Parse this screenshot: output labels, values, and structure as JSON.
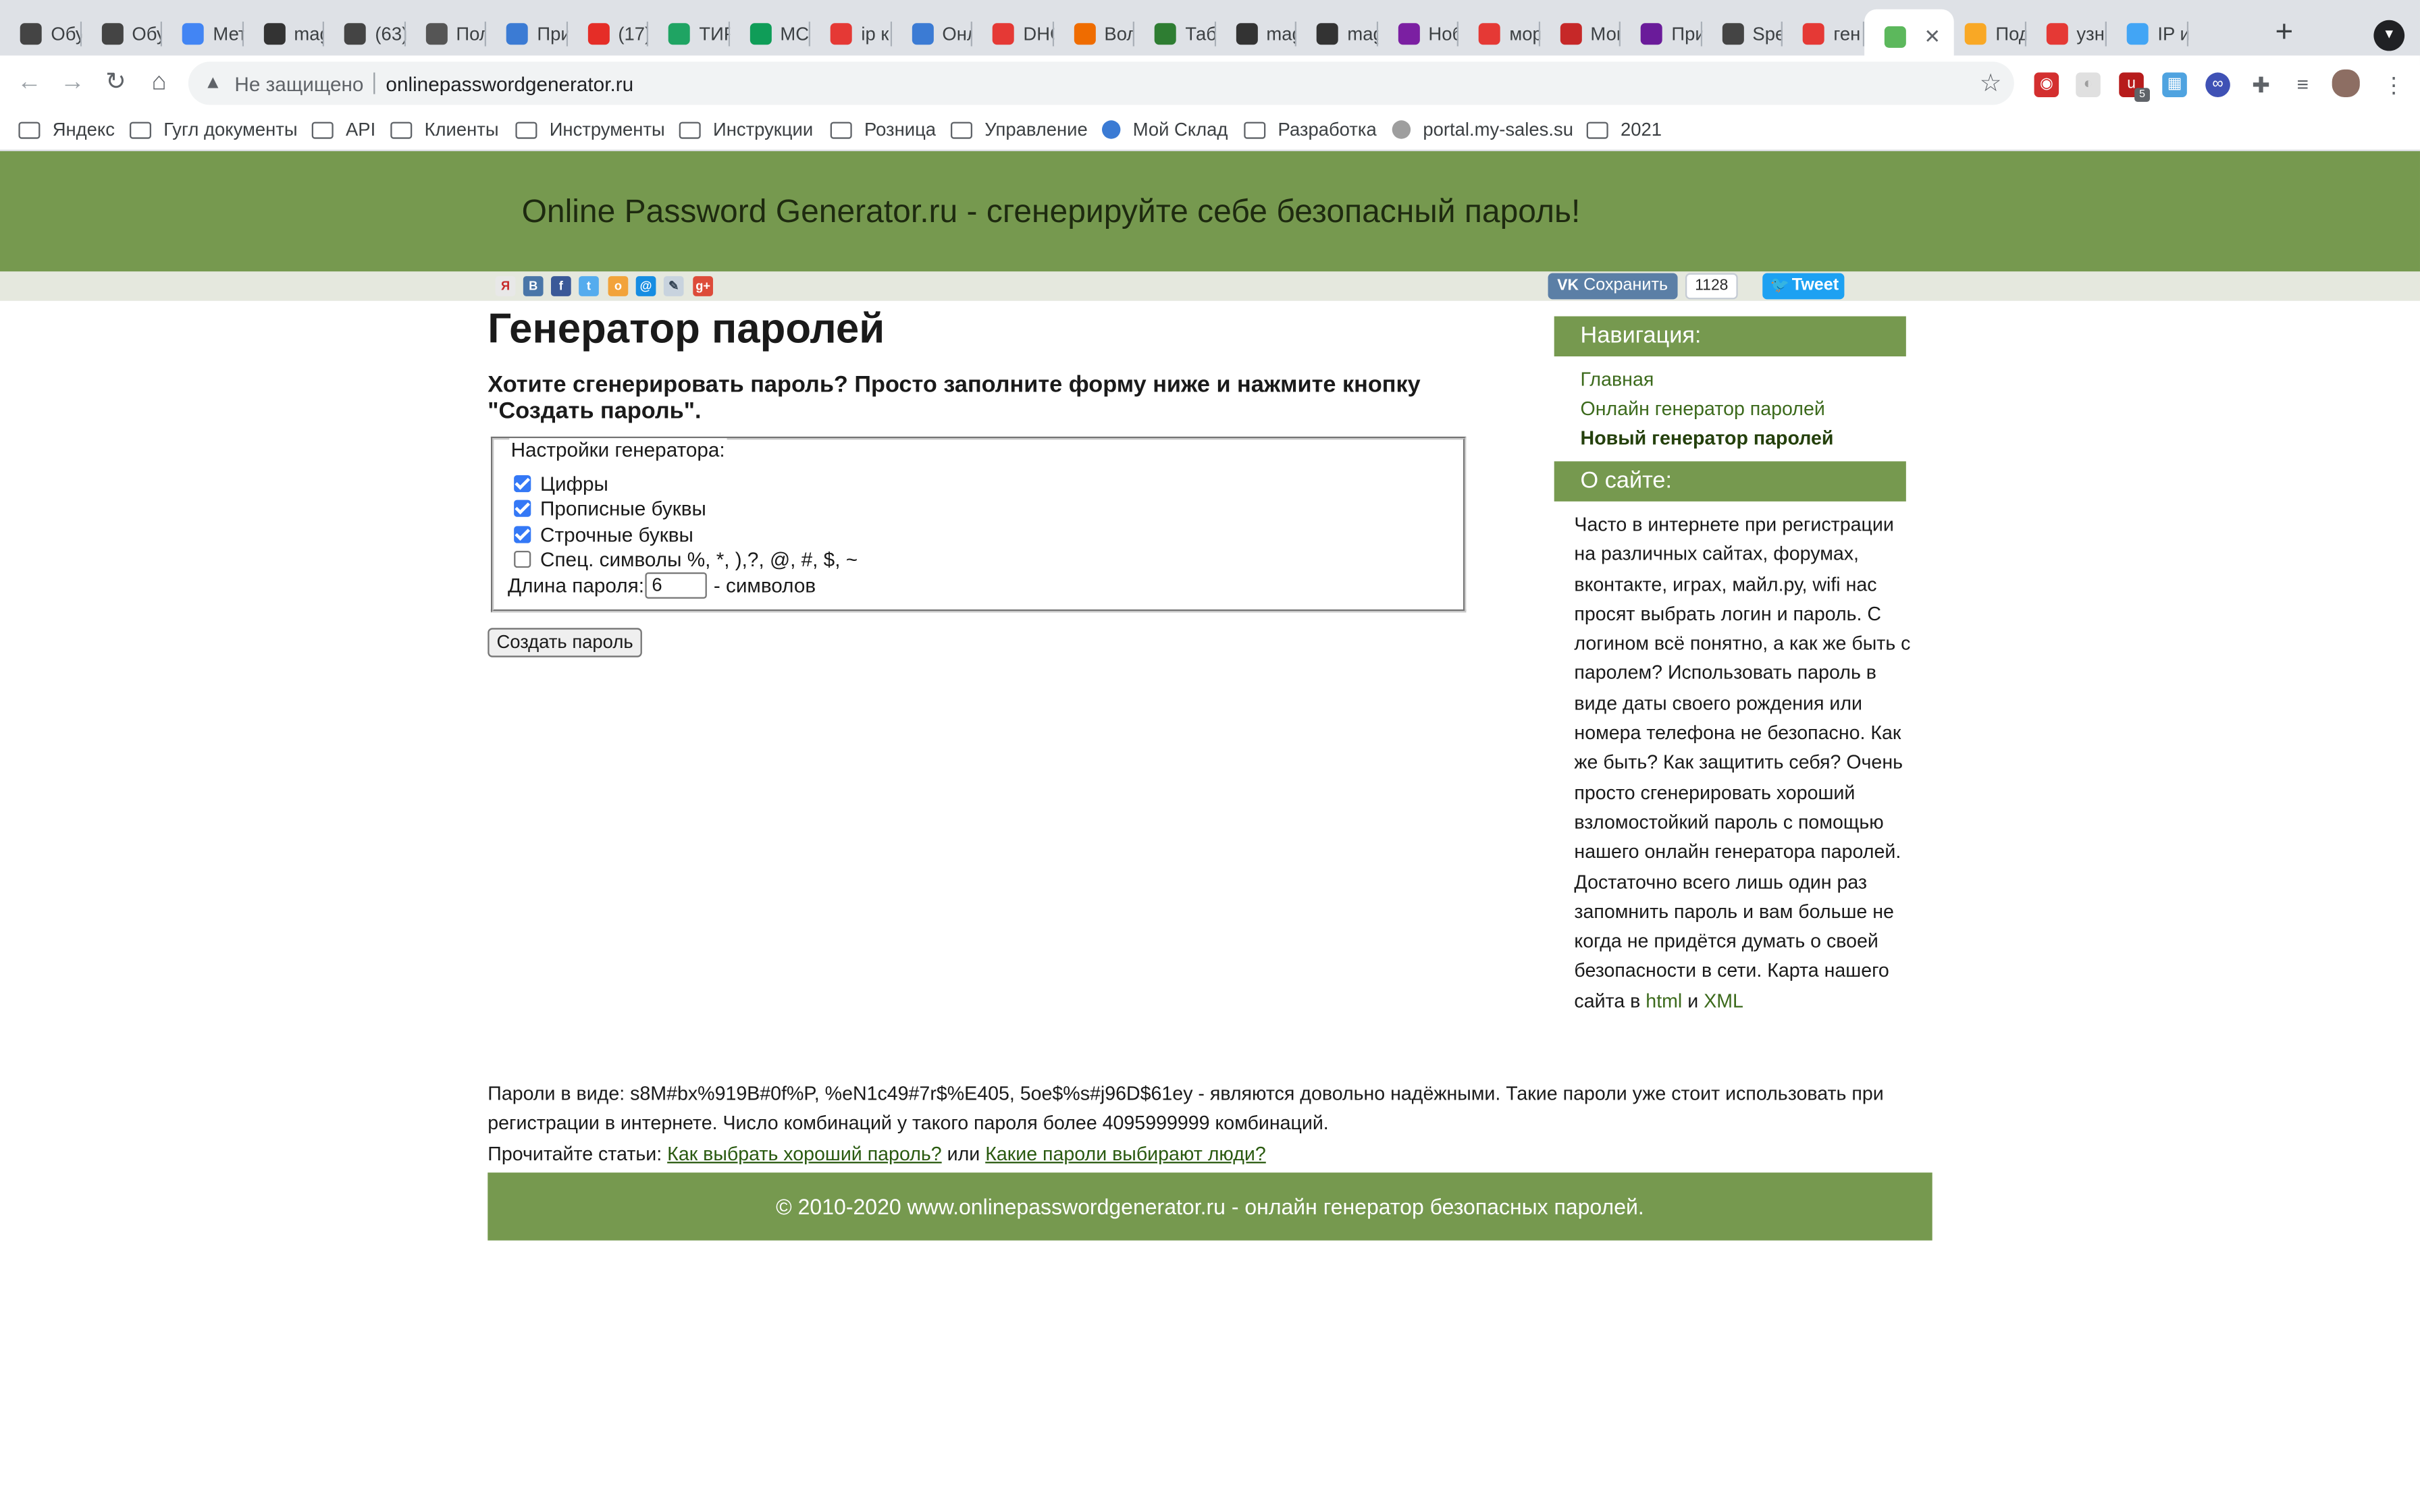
{
  "browser": {
    "tabs": [
      {
        "label": "Обу",
        "color": "#444444"
      },
      {
        "label": "Обу",
        "color": "#444444"
      },
      {
        "label": "Мет",
        "color": "#4285f4"
      },
      {
        "label": "mag",
        "color": "#333333"
      },
      {
        "label": "(63)",
        "color": "#444444"
      },
      {
        "label": "Пол",
        "color": "#555555"
      },
      {
        "label": "При",
        "color": "#3b7bd4"
      },
      {
        "label": "(17)",
        "color": "#e52d27"
      },
      {
        "label": "ТИР",
        "color": "#1fa463"
      },
      {
        "label": "МСС",
        "color": "#0f9d58"
      },
      {
        "label": "ip к",
        "color": "#e53935"
      },
      {
        "label": "Онл",
        "color": "#3b7bd4"
      },
      {
        "label": "DHC",
        "color": "#e53935"
      },
      {
        "label": "Вол",
        "color": "#ef6c00"
      },
      {
        "label": "Таб",
        "color": "#2e7d32"
      },
      {
        "label": "mag",
        "color": "#333333"
      },
      {
        "label": "mag",
        "color": "#333333"
      },
      {
        "label": "Ноб",
        "color": "#7b1fa2"
      },
      {
        "label": "мор",
        "color": "#e53935"
      },
      {
        "label": "Мог",
        "color": "#c62828"
      },
      {
        "label": "При",
        "color": "#6a1b9a"
      },
      {
        "label": "Spe",
        "color": "#444444"
      },
      {
        "label": "ген",
        "color": "#e53935"
      },
      {
        "label": "",
        "color": "#5cb85c"
      },
      {
        "label": "Под",
        "color": "#f9a825"
      },
      {
        "label": "узн",
        "color": "#e53935"
      },
      {
        "label": "IP и",
        "color": "#42a5f5"
      }
    ],
    "omnibox": {
      "security": "Не защищено",
      "url": "onlinepasswordgenerator.ru"
    },
    "bookmarks": [
      {
        "label": "Яндекс",
        "kind": "folder"
      },
      {
        "label": "Гугл документы",
        "kind": "folder"
      },
      {
        "label": "API",
        "kind": "folder"
      },
      {
        "label": "Клиенты",
        "kind": "folder"
      },
      {
        "label": "Инструменты",
        "kind": "folder"
      },
      {
        "label": "Инструкции",
        "kind": "folder"
      },
      {
        "label": "Розница",
        "kind": "folder"
      },
      {
        "label": "Управление",
        "kind": "folder"
      },
      {
        "label": "Мой Склад",
        "kind": "site"
      },
      {
        "label": "Разработка",
        "kind": "folder"
      },
      {
        "label": "portal.my-sales.su",
        "kind": "site"
      },
      {
        "label": "2021",
        "kind": "folder"
      }
    ],
    "extension_badge": "5"
  },
  "page": {
    "header_title": "Online Password Generator.ru - сгенерируйте себе безопасный пароль!",
    "share": {
      "vk_label": "Сохранить",
      "vk_count": "1128",
      "tweet_label": "Tweet"
    },
    "heading": "Генератор паролей",
    "lead": "Хотите сгенерировать пароль? Просто заполните форму ниже и нажмите кнопку \"Создать пароль\".",
    "form": {
      "legend": "Настройки генератора:",
      "options": [
        {
          "label": "Цифры",
          "checked": true
        },
        {
          "label": "Прописные буквы",
          "checked": true
        },
        {
          "label": "Строчные буквы",
          "checked": true
        },
        {
          "label": "Спец. символы %, *, ),?, @, #, $, ~",
          "checked": false
        }
      ],
      "length_label": "Длина пароля:",
      "length_value": "6",
      "length_suffix": "- символов",
      "submit_label": "Создать пароль"
    },
    "sidebar": {
      "nav_heading": "Навигация:",
      "nav_links": [
        {
          "label": "Главная",
          "current": false
        },
        {
          "label": "Онлайн генератор паролей",
          "current": false
        },
        {
          "label": "Новый генератор паролей",
          "current": true
        }
      ],
      "about_heading": "О сайте:",
      "about_text": "Часто в интернете при регистрации на различных сайтах, форумах, вконтакте, играх, майл.ру, wifi нас просят выбрать логин и пароль. С логином всё понятно, а как же быть с паролем? Использовать пароль в виде даты своего рождения или номера телефона не безопасно. Как же быть? Как защитить себя? Очень просто сгенерировать хороший взломостойкий пароль с помощью нашего онлайн генератора паролей. Достаточно всего лишь один раз запомнить пароль и вам больше не когда не придётся думать о своей безопасности в сети. Карта нашего сайта в",
      "about_link_html": "html",
      "about_and": "и",
      "about_link_xml": "XML"
    },
    "bottom": {
      "text": "Пароли в виде: s8M#bx%919B#0f%P, %eN1c49#7r$%E405, 5oe$%s#j96D$61ey - являются довольно надёжными. Такие пароли уже стоит использовать при регистрации в интернете. Число комбинаций у такого пароля более 4095999999 комбинаций.",
      "read_prefix": "Прочитайте статьи:",
      "article1": "Как выбрать хороший пароль?",
      "or": "или",
      "article2": "Какие пароли выбирают люди?"
    },
    "footer": "© 2010-2020 www.onlinepasswordgenerator.ru - онлайн генератор безопасных паролей.",
    "colors": {
      "brand_green": "#76994f",
      "share_bar": "#e5e8de",
      "link_green": "#3c6a1c",
      "vk_blue": "#5b7fa6",
      "twitter_blue": "#1da1f2"
    }
  }
}
